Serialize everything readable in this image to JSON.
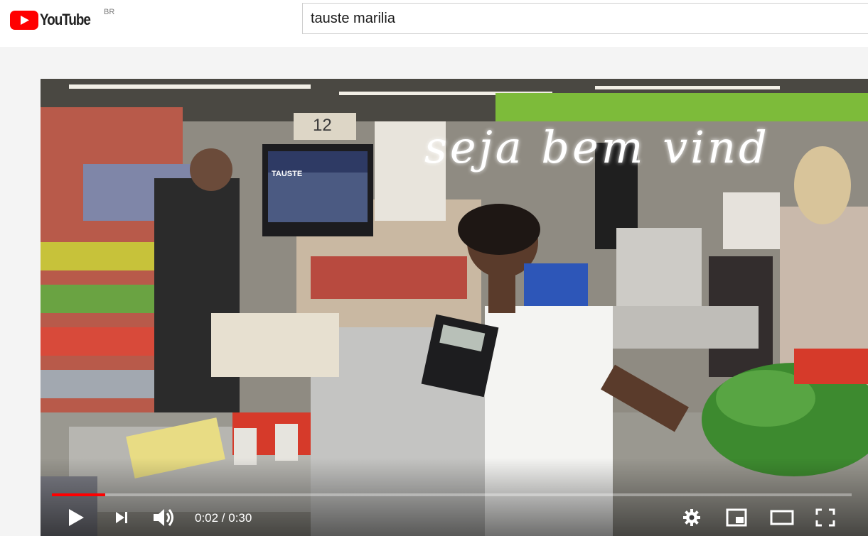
{
  "header": {
    "logo_text": "YouTube",
    "country_code": "BR",
    "search_value": "tauste marilia"
  },
  "video": {
    "overlay_caption": "seja bem vind",
    "lane_number": "12",
    "screen_logo": "TAUSTE",
    "controls": {
      "time_display": "0:02 / 0:30",
      "progress_fraction": 0.0667
    }
  },
  "colors": {
    "brand_red": "#ff0000",
    "player_controls": "#ffffff"
  },
  "icons": [
    "youtube-logo-icon",
    "play-icon",
    "next-icon",
    "volume-icon",
    "settings-gear-icon",
    "miniplayer-icon",
    "theater-mode-icon",
    "fullscreen-icon"
  ]
}
